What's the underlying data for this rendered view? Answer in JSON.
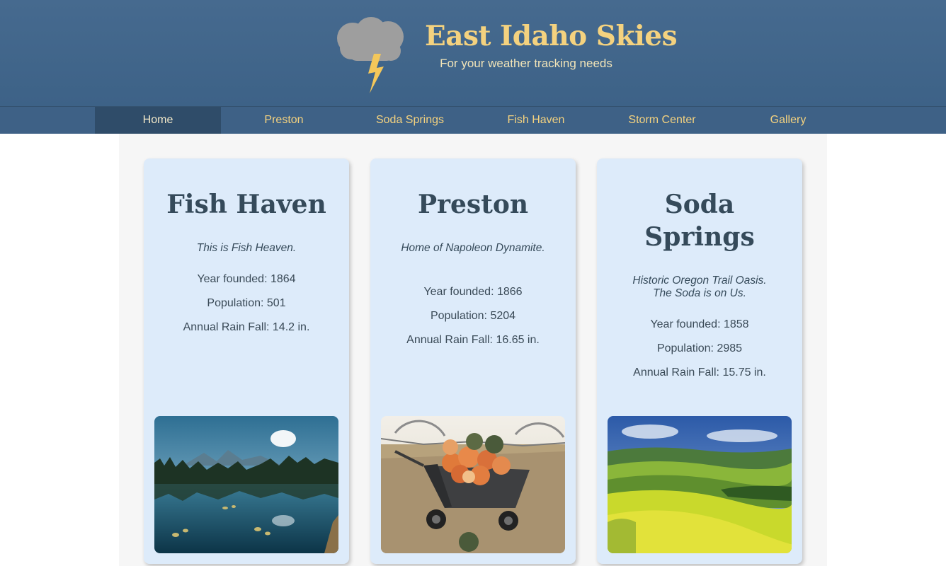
{
  "site": {
    "title": "East Idaho Skies",
    "tagline": "For your weather tracking needs",
    "logo_icon": "storm-cloud-lightning-icon"
  },
  "nav": {
    "items": [
      {
        "label": "Home",
        "active": true
      },
      {
        "label": "Preston",
        "active": false
      },
      {
        "label": "Soda Springs",
        "active": false
      },
      {
        "label": "Fish Haven",
        "active": false
      },
      {
        "label": "Storm Center",
        "active": false
      },
      {
        "label": "Gallery",
        "active": false
      }
    ]
  },
  "towns": [
    {
      "name": "Fish Haven",
      "motto": "This is Fish Heaven.",
      "founded": "Year founded: 1864",
      "population": "Population: 501",
      "rainfall": "Annual Rain Fall: 14.2 in.",
      "photo": "mountain-lake-photo"
    },
    {
      "name": "Preston",
      "motto": "Home of Napoleon Dynamite.",
      "founded": "Year founded: 1866",
      "population": "Population: 5204",
      "rainfall": "Annual Rain Fall: 16.65 in.",
      "photo": "pumpkin-wheelbarrow-photo"
    },
    {
      "name": "Soda Springs",
      "motto": "Historic Oregon Trail Oasis. The Soda is on Us.",
      "founded": "Year founded: 1858",
      "population": "Population: 2985",
      "rainfall": "Annual Rain Fall: 15.75 in.",
      "photo": "rolling-fields-photo"
    }
  ],
  "colors": {
    "header_bg": "#466a8f",
    "nav_bg": "#3e6186",
    "nav_active_bg": "#2f4c69",
    "accent_gold": "#f4d27f",
    "card_bg": "#ddebfa",
    "heading_text": "#354a5a"
  }
}
